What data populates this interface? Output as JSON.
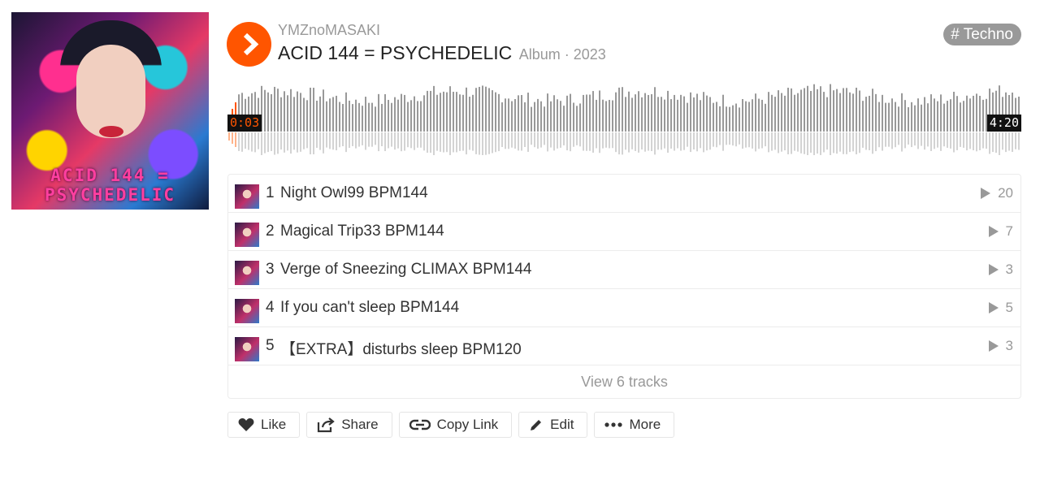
{
  "artwork": {
    "overlay_text": "ACID 144 = PSYCHEDELIC"
  },
  "header": {
    "artist": "YMZnoMASAKI",
    "title": "ACID 144 = PSYCHEDELIC",
    "meta": "Album · 2023",
    "tag": "# Techno"
  },
  "player": {
    "current_time": "0:03",
    "duration": "4:20",
    "progress": 0.012,
    "accent_color": "#ff5500"
  },
  "tracks": [
    {
      "num": "1",
      "title": "Night Owl99 BPM144",
      "plays": "20"
    },
    {
      "num": "2",
      "title": "Magical Trip33 BPM144",
      "plays": "7"
    },
    {
      "num": "3",
      "title": "Verge of Sneezing CLIMAX BPM144",
      "plays": "3"
    },
    {
      "num": "4",
      "title": "If you can't sleep BPM144",
      "plays": "5"
    },
    {
      "num": "5",
      "title": "【EXTRA】disturbs sleep BPM120",
      "plays": "3"
    }
  ],
  "view_all": "View 6 tracks",
  "actions": {
    "like": "Like",
    "share": "Share",
    "copy_link": "Copy Link",
    "edit": "Edit",
    "more": "More"
  }
}
